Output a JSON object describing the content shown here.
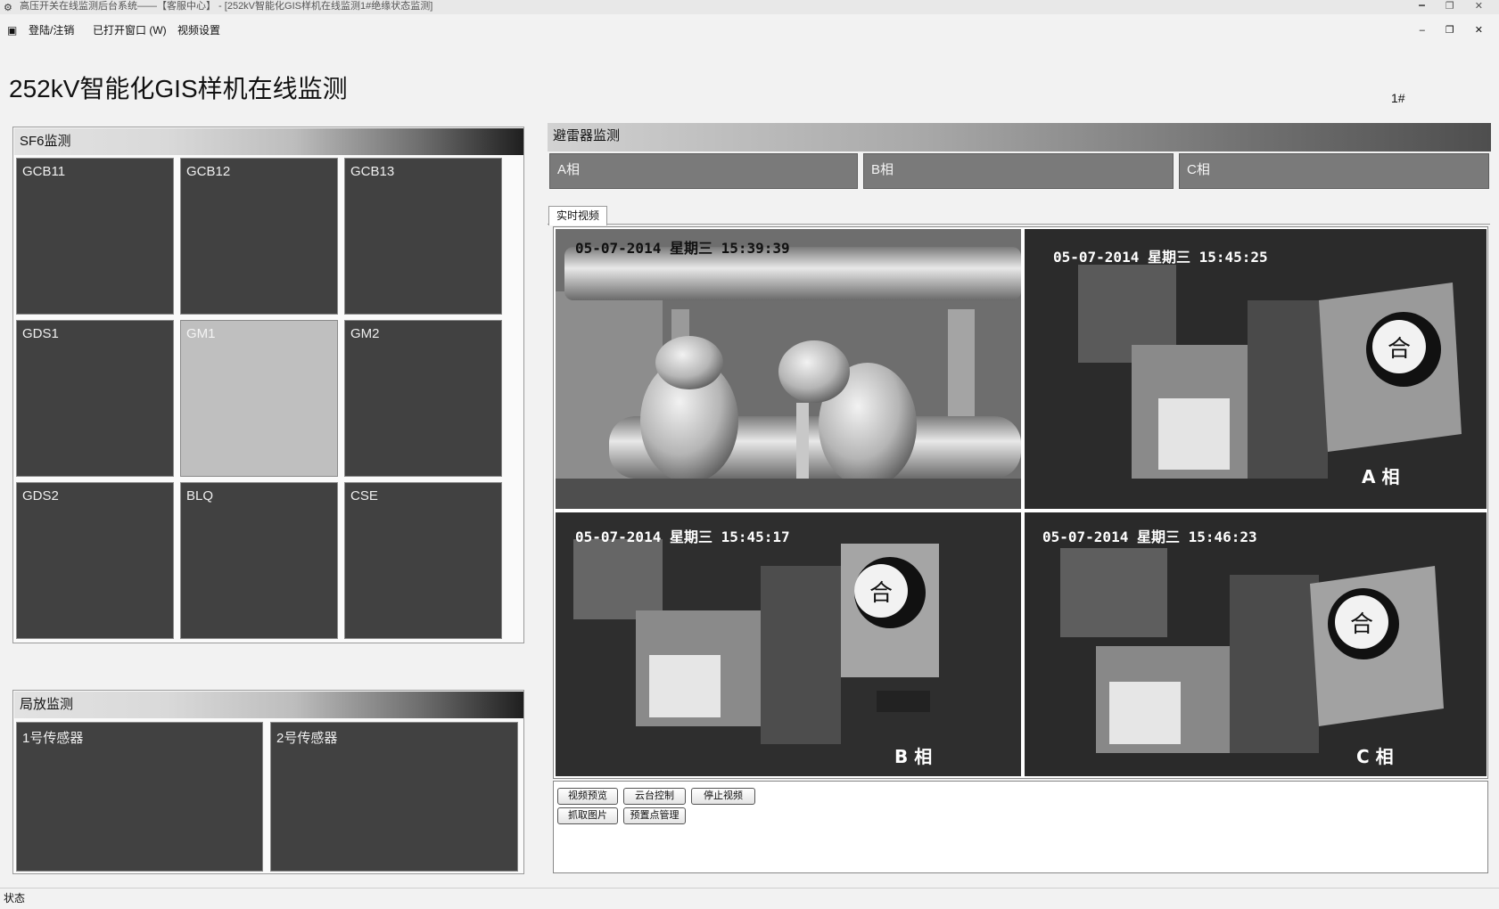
{
  "titlebar": {
    "text": "高压开关在线监测后台系统——【客服中心】 - [252kV智能化GIS样机在线监测1#绝缘状态监测]",
    "controls": "━ ❐ ✕"
  },
  "menu": {
    "items": [
      "登陆/注销",
      "已打开窗口 (W)",
      "视频设置"
    ],
    "mdi_controls": "– ❐ ✕"
  },
  "page": {
    "title": "252kV智能化GIS样机在线监测",
    "unit": "1#"
  },
  "sf6": {
    "title": "SF6监测",
    "tiles": [
      "GCB11",
      "GCB12",
      "GCB13",
      "GDS1",
      "GM1",
      "GM2",
      "GDS2",
      "BLQ",
      "CSE"
    ]
  },
  "pd": {
    "title": "局放监测",
    "sensors": [
      "1号传感器",
      "2号传感器"
    ]
  },
  "arrester": {
    "title": "避雷器监测",
    "phases": [
      "A相",
      "B相",
      "C相"
    ]
  },
  "video": {
    "tab": "实时视频",
    "cams": [
      {
        "timestamp": "05-07-2014 星期三 15:39:39",
        "phase": ""
      },
      {
        "timestamp": "05-07-2014 星期三 15:45:25",
        "phase": "A 相"
      },
      {
        "timestamp": "05-07-2014 星期三 15:45:17",
        "phase": "B 相"
      },
      {
        "timestamp": "05-07-2014 星期三 15:46:23",
        "phase": "C 相"
      }
    ],
    "indicator_glyph": "合",
    "controls": [
      "视频预览",
      "云台控制",
      "停止视频",
      "抓取图片",
      "预置点管理"
    ]
  },
  "statusbar": {
    "text": "状态"
  },
  "colors": {
    "tile_dark": "#414141",
    "tile_light": "#bfbfbf",
    "phase_bar": "#7a7a7a"
  }
}
